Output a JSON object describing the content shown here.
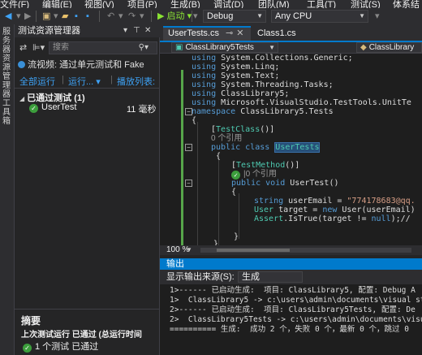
{
  "menu": [
    "文件(F)",
    "编辑(E)",
    "视图(V)",
    "项目(P)",
    "生成(B)",
    "调试(D)",
    "团队(M)",
    "工具(T)",
    "测试(S)",
    "体系结"
  ],
  "toolbar": {
    "start_label": "▶ 启动 ▾",
    "config": "Debug",
    "platform": "Any CPU"
  },
  "left_strip": {
    "text": "服务器资源管理器工具箱"
  },
  "test_explorer": {
    "title": "测试资源管理器",
    "search_placeholder": "搜索",
    "notice": "流视频: 通过单元测试和 Fake",
    "run_all": "全部运行",
    "run_menu": "运行... ▾",
    "playlist": "播放列表:",
    "group_header": "已通过测试 (1)",
    "test_name": "UserTest",
    "test_time": "11 毫秒",
    "summary_title": "摘要",
    "summary_last": "上次测试运行 已通过 (总运行时间",
    "summary_result": "1 个测试 已通过"
  },
  "tabs": [
    {
      "label": "UserTests.cs",
      "active": true
    },
    {
      "label": "Class1.cs",
      "active": false
    }
  ],
  "navbar": {
    "left": "ClassLibrary5Tests",
    "right": "ClassLibrary"
  },
  "code": {
    "line1": "System.Collections.Generic;",
    "line2": "System.Linq;",
    "line3": "System.Text;",
    "line4": "System.Threading.Tasks;",
    "line5": "ClassLibrary5;",
    "line6": "Microsoft.VisualStudio.TestTools.UnitTe",
    "kw_using": "using",
    "kw_namespace": "namespace",
    "ns_name": "ClassLibrary5.Tests",
    "brace_open": "{",
    "brace_close": "}",
    "attr_testclass": "TestClass",
    "refs0": "0 个引用",
    "kw_public": "public",
    "kw_class": "class",
    "class_name": "UserTests",
    "attr_testmethod": "TestMethod",
    "refs_method": "|0 个引用",
    "kw_void": "void",
    "method_name": "UserTest()",
    "kw_string": "string",
    "var_email": "userEmail = ",
    "email_value": "\"774178683@qq.",
    "user_type": "User",
    "target_line": " target = ",
    "kw_new": "new",
    "new_user": " User(userEmail)",
    "assert_type": "Assert",
    "assert_call": ".IsTrue(target != ",
    "kw_null": "null",
    "assert_end": ");//"
  },
  "zoom": "100 %",
  "output": {
    "title": "输出",
    "source_label": "显示输出来源(S):",
    "source_value": "生成",
    "lines": [
      "1>------ 已启动生成:  项目: ClassLibrary5, 配置: Debug A",
      "1>  ClassLibrary5 -> c:\\users\\admin\\documents\\visual stu",
      "2>------ 已启动生成:  项目: ClassLibrary5Tests, 配置: De",
      "2>  ClassLibrary5Tests -> c:\\users\\admin\\documents\\visu",
      "========== 生成:  成功 2 个，失败 0 个，最新 0 个，跳过 0"
    ]
  }
}
